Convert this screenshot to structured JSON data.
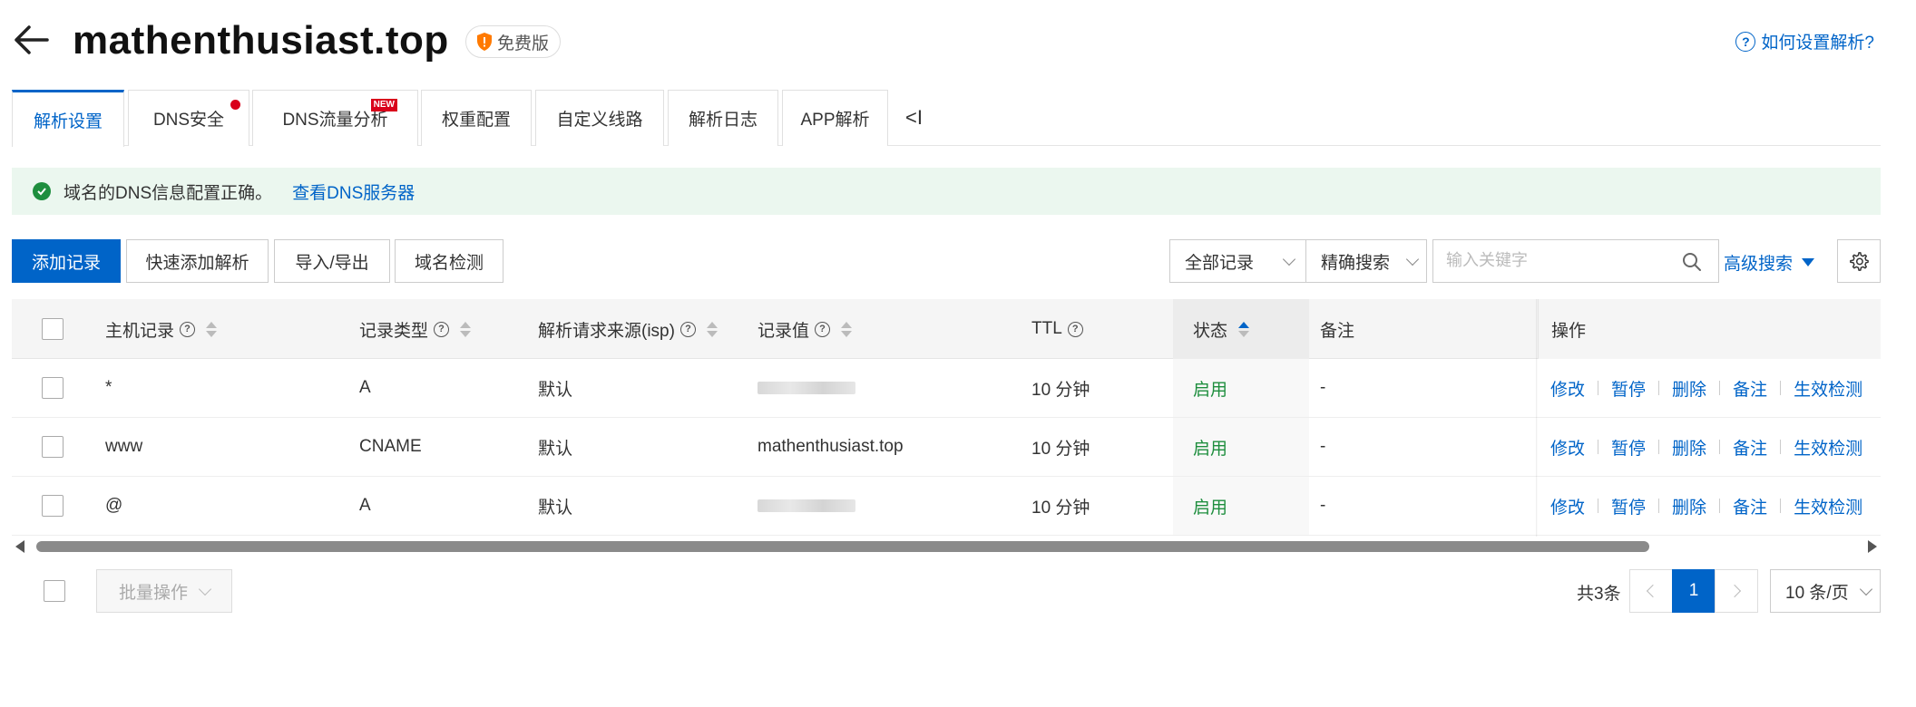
{
  "header": {
    "domain": "mathenthusiast.top",
    "plan_badge": "免费版",
    "help_link": "如何设置解析?"
  },
  "tabs": [
    {
      "label": "解析设置",
      "active": true
    },
    {
      "label": "DNS安全",
      "dot": true
    },
    {
      "label": "DNS流量分析",
      "badge": "NEW"
    },
    {
      "label": "权重配置"
    },
    {
      "label": "自定义线路"
    },
    {
      "label": "解析日志"
    },
    {
      "label": "APP解析"
    }
  ],
  "tabs_collapse": "<I",
  "notice": {
    "text": "域名的DNS信息配置正确。",
    "link": "查看DNS服务器"
  },
  "toolbar": {
    "add_record": "添加记录",
    "quick_add": "快速添加解析",
    "import_export": "导入/导出",
    "domain_check": "域名检测",
    "filter_select": "全部记录",
    "match_select": "精确搜索",
    "search_placeholder": "输入关键字",
    "advanced_search": "高级搜索"
  },
  "table": {
    "columns": {
      "host": "主机记录",
      "type": "记录类型",
      "isp": "解析请求来源(isp)",
      "value": "记录值",
      "ttl": "TTL",
      "status": "状态",
      "remark": "备注",
      "actions": "操作"
    },
    "rows": [
      {
        "host": "*",
        "type": "A",
        "isp": "默认",
        "value": "",
        "value_masked": true,
        "ttl": "10 分钟",
        "status": "启用",
        "remark": "-"
      },
      {
        "host": "www",
        "type": "CNAME",
        "isp": "默认",
        "value": "mathenthusiast.top",
        "value_masked": false,
        "ttl": "10 分钟",
        "status": "启用",
        "remark": "-"
      },
      {
        "host": "@",
        "type": "A",
        "isp": "默认",
        "value": "",
        "value_masked": true,
        "ttl": "10 分钟",
        "status": "启用",
        "remark": "-"
      }
    ],
    "actions": {
      "edit": "修改",
      "pause": "暂停",
      "delete": "删除",
      "remark": "备注",
      "check": "生效检测"
    }
  },
  "footer": {
    "batch": "批量操作",
    "total": "共3条",
    "current_page": "1",
    "page_size": "10 条/页"
  },
  "colors": {
    "primary": "#0064c8",
    "success": "#1e8e3e",
    "danger": "#d9001b",
    "notice_bg": "#ebf7ef"
  }
}
